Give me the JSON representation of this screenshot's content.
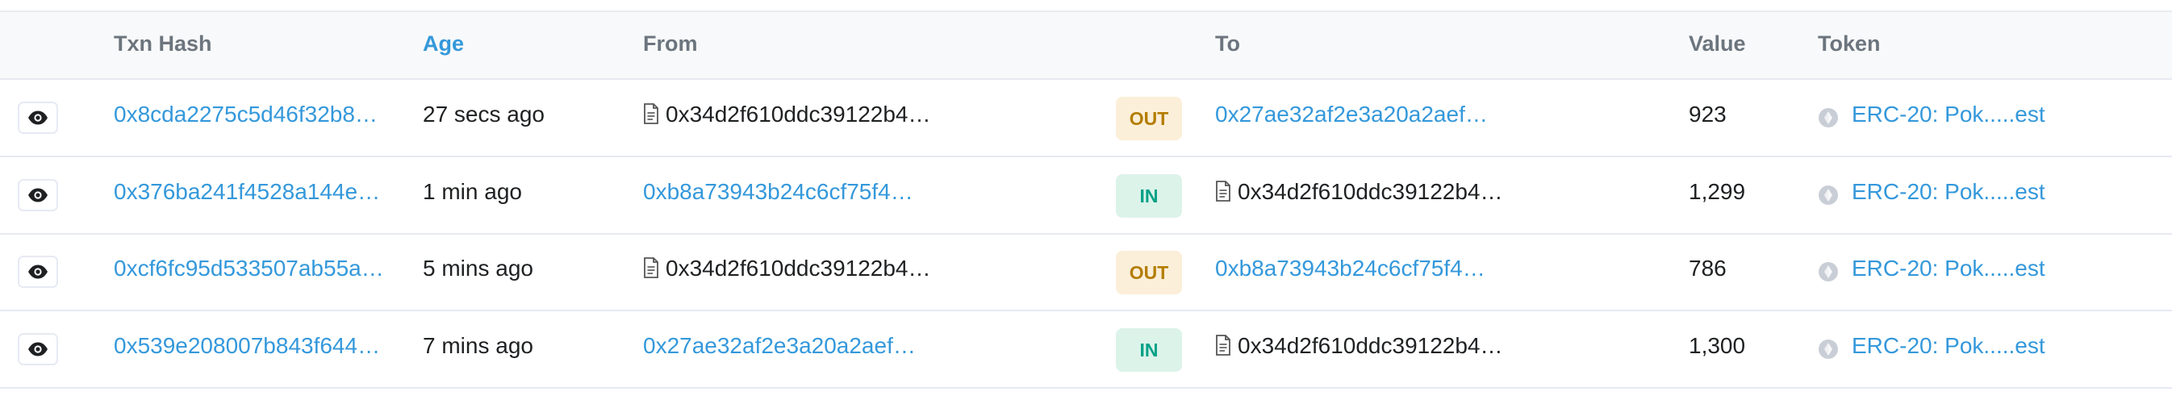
{
  "header": {
    "txn_hash": "Txn Hash",
    "age": "Age",
    "from": "From",
    "to": "To",
    "value": "Value",
    "token": "Token"
  },
  "rows": [
    {
      "hash": "0x8cda2275c5d46f32b8…",
      "age": "27 secs ago",
      "from": "0x34d2f610ddc39122b4…",
      "direction": "OUT",
      "to": "0x27ae32af2e3a20a2aef…",
      "value": "923",
      "token": "ERC-20: Pok.....est"
    },
    {
      "hash": "0x376ba241f4528a144e…",
      "age": "1 min ago",
      "from": "0xb8a73943b24c6cf75f4…",
      "direction": "IN",
      "to": "0x34d2f610ddc39122b4…",
      "value": "1,299",
      "token": "ERC-20: Pok.....est"
    },
    {
      "hash": "0xcf6fc95d533507ab55a…",
      "age": "5 mins ago",
      "from": "0x34d2f610ddc39122b4…",
      "direction": "OUT",
      "to": "0xb8a73943b24c6cf75f4…",
      "value": "786",
      "token": "ERC-20: Pok.....est"
    },
    {
      "hash": "0x539e208007b843f644…",
      "age": "7 mins ago",
      "from": "0x27ae32af2e3a20a2aef…",
      "direction": "IN",
      "to": "0x34d2f610ddc39122b4…",
      "value": "1,300",
      "token": "ERC-20: Pok.....est"
    }
  ],
  "icons": {
    "view": "eye-icon",
    "contract": "document-icon",
    "token": "token-logo-icon"
  },
  "colors": {
    "link": "#3498db",
    "out_bg": "#fbefd9",
    "out_text": "#b47d00",
    "in_bg": "#dcf3ea",
    "in_text": "#00a186"
  }
}
